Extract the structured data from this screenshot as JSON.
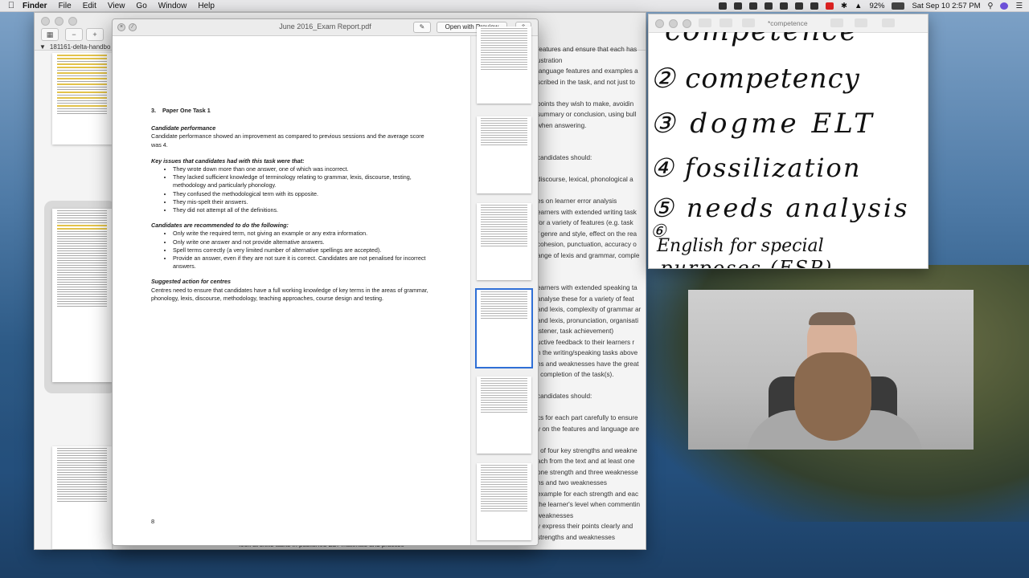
{
  "menubar": {
    "app": "Finder",
    "items": [
      "File",
      "Edit",
      "View",
      "Go",
      "Window",
      "Help"
    ],
    "battery": "92%",
    "datetime": "Sat Sep 10  2:57 PM"
  },
  "back_window": {
    "sidebar_file": "181161-delta-handbo",
    "text_lines": [
      "features and ensure that each has",
      "ustration",
      "language features and examples a",
      "scribed in the task, and not just to",
      "",
      "points they wish to make, avoidin",
      "summary or conclusion, using bull",
      "when answering.",
      "",
      "",
      "candidates should:",
      "",
      "discourse, lexical, phonological a",
      "",
      "es on learner error analysis",
      "earners with extended writing task",
      "for a variety of features (e.g. task",
      "f genre and style, effect on the rea",
      "cohesion, punctuation, accuracy o",
      "ange of lexis and grammar, comple",
      "",
      "",
      "earners with extended speaking ta",
      "analyse these for a variety of feat",
      "and lexis, complexity of grammar ar",
      "and lexis, pronunciation, organisati",
      "istener, task achievement)",
      "uctive feedback to their learners r",
      "n the writing/speaking tasks above",
      "hs and weaknesses have the great",
      "l completion of the task(s).",
      "",
      "candidates should:",
      "",
      "cs for each part carefully to ensure",
      "y on the features and language are",
      "",
      "l of four key strengths and weakne",
      "ach from the text and at least one",
      "one strength and three weaknesse",
      "hs and two weaknesses",
      "example for each strength and eac",
      "the learner's level when commentin",
      "weaknesses",
      "y express their points clearly and",
      "strengths and weaknesses"
    ],
    "bottom_line": "look at skills tasks in published ELT materials and practise"
  },
  "pdf": {
    "title": "June 2016_Exam Report.pdf",
    "open_with_preview": "Open with Preview",
    "section_number": "3.",
    "section_title": "Paper One Task 1",
    "perf_heading": "Candidate performance",
    "perf_text": "Candidate performance showed an improvement as compared to previous sessions and the average score was 4.",
    "issues_heading": "Key issues that candidates had with this task were that:",
    "issues": [
      "They wrote down more than one answer, one of which was incorrect.",
      "They lacked sufficient knowledge of terminology relating to grammar, lexis, discourse, testing, methodology and particularly phonology.",
      "They confused the methodological term with its opposite.",
      "They mis-spelt their answers.",
      "They did not attempt all of the definitions."
    ],
    "recommend_heading": "Candidates are recommended to do the following:",
    "recommendations": [
      "Only write the required term, not giving an example or any extra information.",
      "Only write one answer and not provide alternative answers.",
      "Spell terms correctly (a very limited number of alternative spellings are accepted).",
      "Provide an answer, even if they are not sure it is correct. Candidates are not penalised for incorrect answers."
    ],
    "action_heading": "Suggested action for centres",
    "action_text": "Centres need to ensure that candidates have a full working knowledge of key terms in the areas of grammar, phonology, lexis, discourse, methodology, teaching approaches, course design and testing.",
    "page_number": "8"
  },
  "notes": {
    "title": "*competence",
    "lines": [
      "competence",
      "② competency",
      "③ dogme ELT",
      "④ fossilization",
      "⑤ needs analysis",
      "⑥",
      "English for special",
      "purposes (ESP)"
    ]
  }
}
